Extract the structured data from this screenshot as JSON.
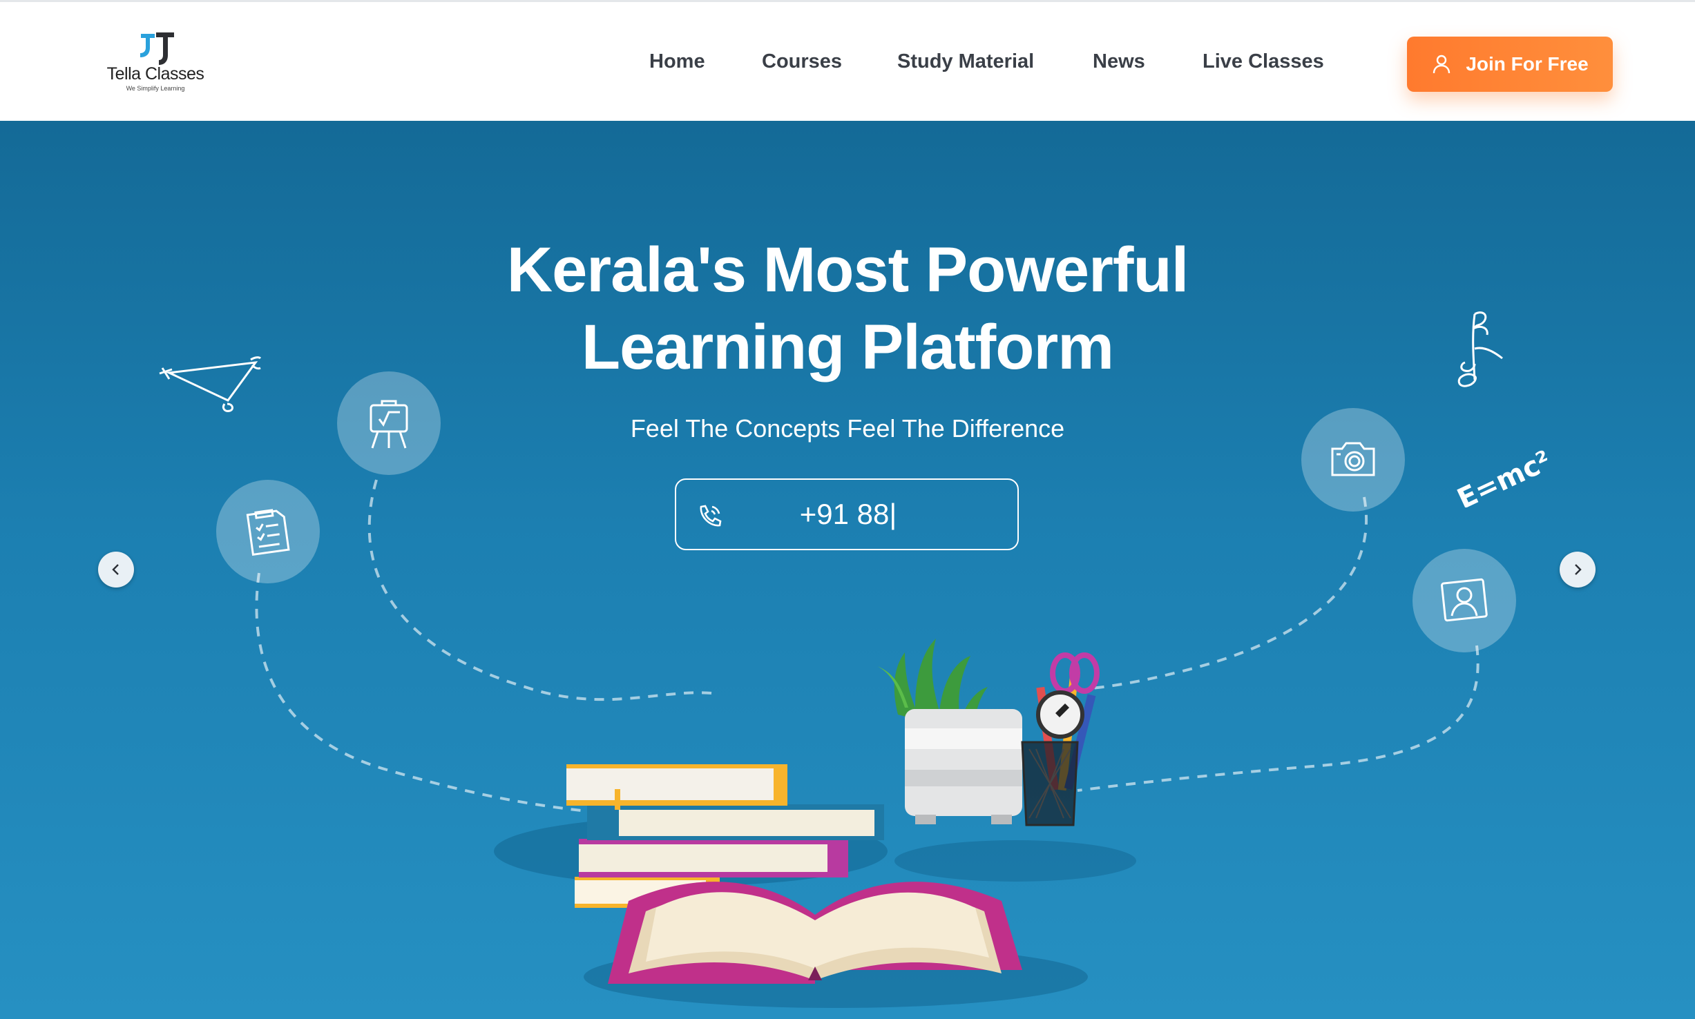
{
  "brand": {
    "name": "Tella Classes",
    "tagline": "We Simplify Learning",
    "logo_icon": "tc-monogram-icon"
  },
  "nav": {
    "items": [
      "Home",
      "Courses",
      "Study Material",
      "News",
      "Live Classes"
    ]
  },
  "cta": {
    "label": "Join For Free",
    "icon": "user-icon",
    "color": "#ff8133"
  },
  "hero": {
    "title_line1": "Kerala's Most Powerful",
    "title_line2": "Learning Platform",
    "subtitle": "Feel The Concepts Feel The Difference",
    "phone_value": "+91 88|",
    "phone_icon": "phone-icon",
    "background_color": "#1a7cb0"
  },
  "decor": {
    "formula": "E=mc²",
    "icons": [
      "triangle-doodle",
      "easel-sqrt-icon",
      "checklist-icon",
      "music-note-doodle",
      "camera-icon",
      "profile-photo-icon",
      "books-stack",
      "plant-pot",
      "pencil-cup",
      "open-book"
    ]
  },
  "carousel": {
    "prev_icon": "chevron-left-icon",
    "next_icon": "chevron-right-icon"
  }
}
